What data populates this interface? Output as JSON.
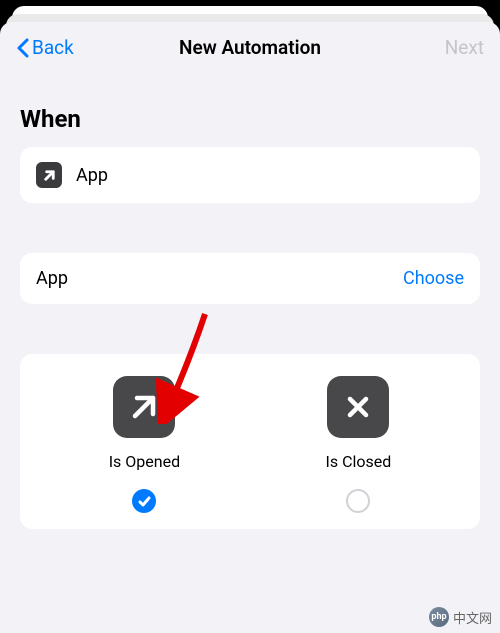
{
  "nav": {
    "back": "Back",
    "title": "New Automation",
    "next": "Next"
  },
  "section": {
    "header": "When"
  },
  "appCard": {
    "label": "App"
  },
  "chooseCard": {
    "label": "App",
    "action": "Choose"
  },
  "options": {
    "opened": {
      "label": "Is Opened",
      "selected": true
    },
    "closed": {
      "label": "Is Closed",
      "selected": false
    }
  },
  "watermark": {
    "badge": "php",
    "text": "中文网"
  }
}
